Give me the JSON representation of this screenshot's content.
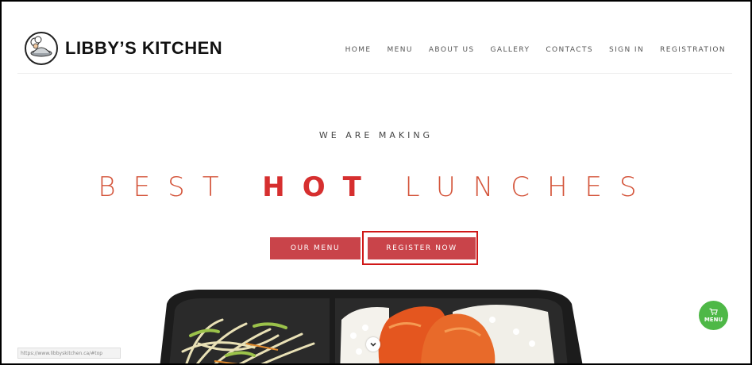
{
  "brand": {
    "name": "LIBBY’S KITCHEN",
    "logo_icon": "chef-plate-icon"
  },
  "nav": {
    "items": [
      "HOME",
      "MENU",
      "ABOUT US",
      "GALLERY",
      "CONTACTS",
      "SIGN IN",
      "REGISTRATION"
    ]
  },
  "hero": {
    "subtitle": "WE ARE MAKING",
    "headline_pre": "BEST",
    "headline_hot": "HOT",
    "headline_post": "LUNCHES",
    "our_menu_label": "OUR MENU",
    "register_label": "REGISTER NOW",
    "image": "bento-lunch-box-photo",
    "scroll_icon": "chevron-down-icon"
  },
  "floating": {
    "label": "MENU",
    "icon": "cart-icon"
  },
  "status": {
    "url": "https://www.libbyskitchen.ca/#top"
  },
  "colors": {
    "accent": "#c9444a",
    "headline": "#d4543a",
    "hot": "#d62f2f",
    "cart": "#4eb847",
    "highlight": "#d01818"
  }
}
